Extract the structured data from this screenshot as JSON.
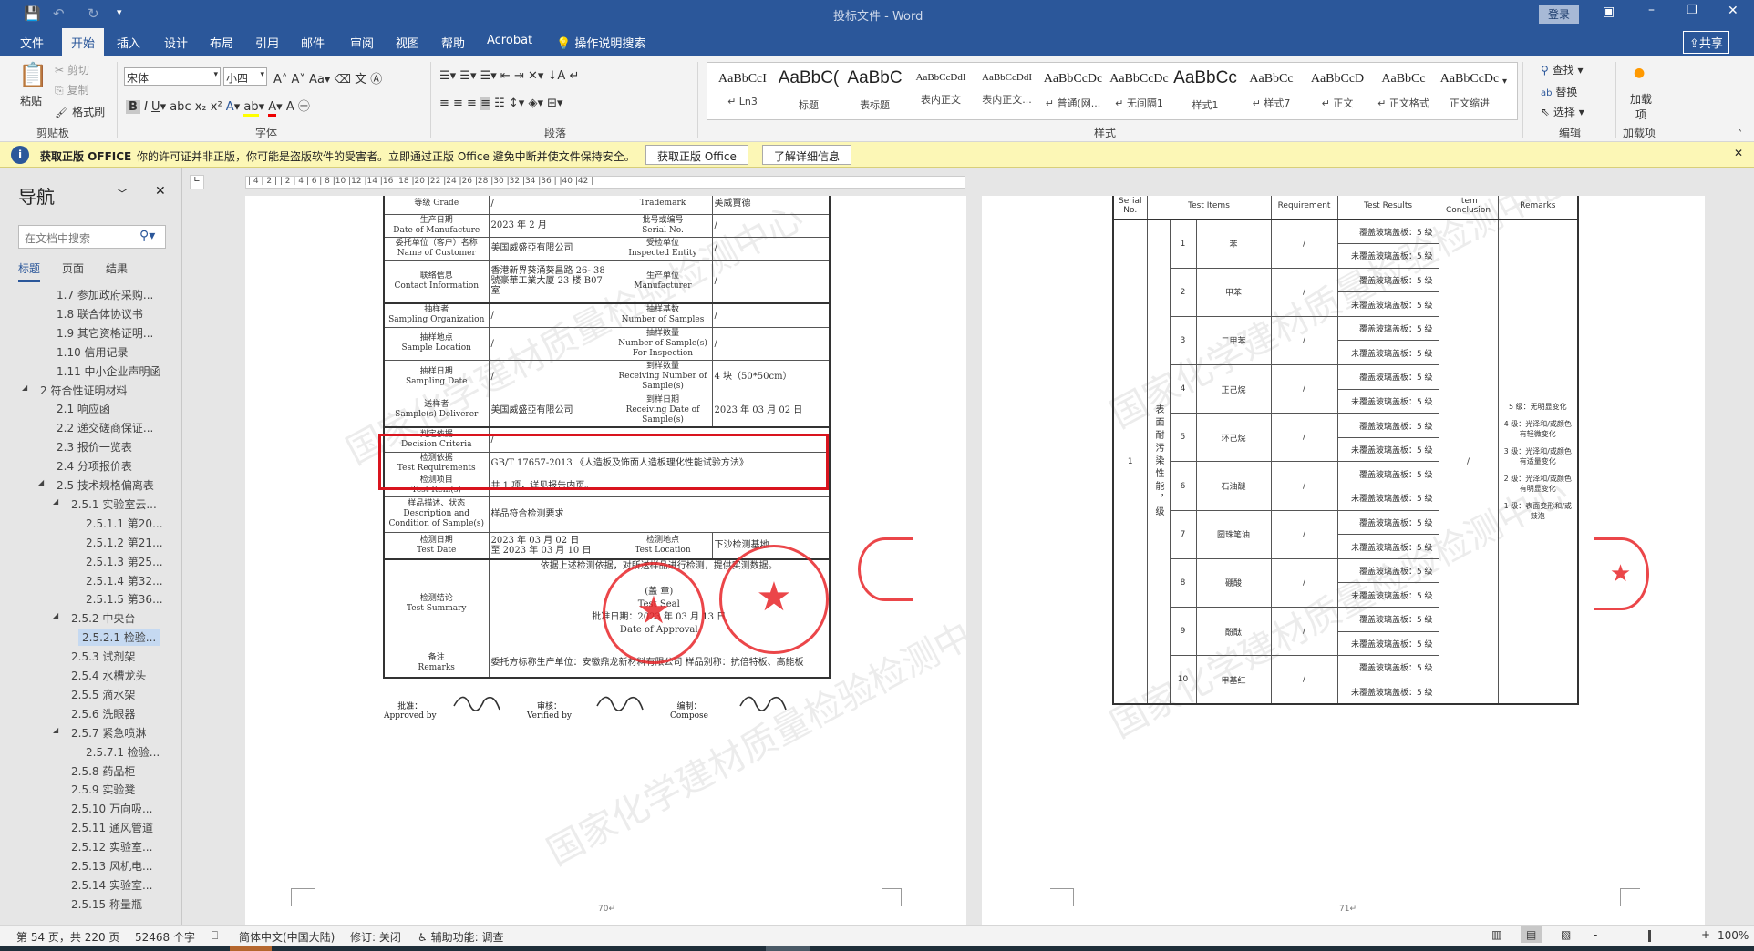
{
  "window": {
    "title": "投标文件 - Word",
    "login": "登录",
    "share": "共享"
  },
  "tabs": [
    "文件",
    "开始",
    "插入",
    "设计",
    "布局",
    "引用",
    "邮件",
    "审阅",
    "视图",
    "帮助",
    "Acrobat"
  ],
  "tell_me": "操作说明搜索",
  "ribbon": {
    "clipboard": {
      "paste": "粘贴",
      "cut": "剪切",
      "copy": "复制",
      "format_painter": "格式刷",
      "label": "剪贴板"
    },
    "font": {
      "name": "宋体",
      "size": "小四",
      "label": "字体"
    },
    "paragraph": {
      "label": "段落"
    },
    "styles": {
      "label": "样式",
      "items": [
        {
          "preview": "AaBbCcI",
          "name": "↵ Ln3"
        },
        {
          "preview": "AaBbC(",
          "name": "标题"
        },
        {
          "preview": "AaBbC",
          "name": "表标题"
        },
        {
          "preview": "AaBbCcDdI",
          "name": "表内正文"
        },
        {
          "preview": "AaBbCcDdI",
          "name": "表内正文..."
        },
        {
          "preview": "AaBbCcDc",
          "name": "↵ 普通(网..."
        },
        {
          "preview": "AaBbCcDc",
          "name": "↵ 无间隔1"
        },
        {
          "preview": "AaBbCc",
          "name": "样式1"
        },
        {
          "preview": "AaBbCc",
          "name": "↵ 样式7"
        },
        {
          "preview": "AaBbCcD",
          "name": "↵ 正文"
        },
        {
          "preview": "AaBbCc",
          "name": "↵ 正文格式"
        },
        {
          "preview": "AaBbCcDc",
          "name": "正文缩进"
        }
      ]
    },
    "editing": {
      "find": "查找",
      "replace": "替换",
      "select": "选择",
      "label": "编辑"
    },
    "addins": {
      "button": "加载项",
      "label": "加载项"
    }
  },
  "message_bar": {
    "title": "获取正版 OFFICE",
    "text": "你的许可证并非正版，你可能是盗版软件的受害者。立即通过正版 Office 避免中断并使文件保持安全。",
    "btn1": "获取正版 Office",
    "btn2": "了解详细信息"
  },
  "nav": {
    "title": "导航",
    "search_placeholder": "在文档中搜索",
    "tabs": [
      "标题",
      "页面",
      "结果"
    ],
    "items": [
      {
        "t": "1.7 参加政府采购...",
        "l": 3
      },
      {
        "t": "1.8 联合体协议书",
        "l": 3
      },
      {
        "t": "1.9 其它资格证明...",
        "l": 3
      },
      {
        "t": "1.10 信用记录",
        "l": 3
      },
      {
        "t": "1.11 中小企业声明函",
        "l": 3
      },
      {
        "t": "2 符合性证明材料",
        "l": 1,
        "c": true
      },
      {
        "t": "2.1 响应函",
        "l": 3
      },
      {
        "t": "2.2 递交磋商保证...",
        "l": 3
      },
      {
        "t": "2.3 报价一览表",
        "l": 3
      },
      {
        "t": "2.4 分项报价表",
        "l": 3
      },
      {
        "t": "2.5 技术规格偏离表",
        "l": 3,
        "c": true
      },
      {
        "t": "2.5.1 实验室云...",
        "l": 4,
        "c": true
      },
      {
        "t": "2.5.1.1 第20...",
        "l": 5
      },
      {
        "t": "2.5.1.2 第21...",
        "l": 5
      },
      {
        "t": "2.5.1.3 第25...",
        "l": 5
      },
      {
        "t": "2.5.1.4 第32...",
        "l": 5
      },
      {
        "t": "2.5.1.5 第36...",
        "l": 5
      },
      {
        "t": "2.5.2 中央台",
        "l": 4,
        "c": true
      },
      {
        "t": "2.5.2.1 检验...",
        "l": 5,
        "sel": true
      },
      {
        "t": "2.5.3 试剂架",
        "l": 4
      },
      {
        "t": "2.5.4 水槽龙头",
        "l": 4
      },
      {
        "t": "2.5.5 滴水架",
        "l": 4
      },
      {
        "t": "2.5.6 洗眼器",
        "l": 4
      },
      {
        "t": "2.5.7 紧急喷淋",
        "l": 4,
        "c": true
      },
      {
        "t": "2.5.7.1 检验...",
        "l": 5
      },
      {
        "t": "2.5.8 药品柜",
        "l": 4
      },
      {
        "t": "2.5.9 实验凳",
        "l": 4
      },
      {
        "t": "2.5.10 万向吸...",
        "l": 4
      },
      {
        "t": "2.5.11 通风管道",
        "l": 4
      },
      {
        "t": "2.5.12 实验室...",
        "l": 4
      },
      {
        "t": "2.5.13 风机电...",
        "l": 4
      },
      {
        "t": "2.5.14 实验室...",
        "l": 4
      },
      {
        "t": "2.5.15 称量瓶",
        "l": 4
      }
    ]
  },
  "ruler": "| 4 |  2 |  | 2 | 4 | 6 | 8 |10 |12 |14 |16 |18 |20 |22 |24 |26 |28 |30 |32 |34 |36 |  |40 |42 |",
  "left_page": {
    "rows": [
      [
        {
          "t": "等级 Grade"
        },
        {
          "t": "/",
          "v": 1
        },
        {
          "t": "Trademark"
        },
        {
          "t": "美威賈德",
          "v": 1
        }
      ],
      [
        {
          "t": "生产日期\nDate of Manufacture"
        },
        {
          "t": "2023 年 2 月",
          "v": 1
        },
        {
          "t": "批号或编号\nSerial No."
        },
        {
          "t": "/",
          "v": 1
        }
      ],
      [
        {
          "t": "委托单位（客户）名称\nName of Customer"
        },
        {
          "t": "美国威盛亞有限公司",
          "v": 1
        },
        {
          "t": "受检单位\nInspected Entity"
        },
        {
          "t": "/",
          "v": 1
        }
      ],
      [
        {
          "t": "联络信息\nContact Information"
        },
        {
          "t": "香港新界葵涌葵昌路 26- 38 號豪華工業大厦 23 楼 B07 室",
          "v": 1
        },
        {
          "t": "生产单位\nManufacturer"
        },
        {
          "t": "/",
          "v": 1
        }
      ],
      [
        {
          "t": "抽样者\nSampling Organization"
        },
        {
          "t": "/",
          "v": 1
        },
        {
          "t": "抽样基数\nNumber of Samples"
        },
        {
          "t": "/",
          "v": 1
        }
      ],
      [
        {
          "t": "抽样地点\nSample Location"
        },
        {
          "t": "/",
          "v": 1
        },
        {
          "t": "抽样数量\nNumber of Sample(s)\nFor Inspection"
        },
        {
          "t": "/",
          "v": 1
        }
      ],
      [
        {
          "t": "抽样日期\nSampling Date"
        },
        {
          "t": "/",
          "v": 1
        },
        {
          "t": "到样数量\nReceiving Number of\nSample(s)"
        },
        {
          "t": "4 块（50*50cm）",
          "v": 1
        }
      ],
      [
        {
          "t": "送样者\nSample(s) Deliverer"
        },
        {
          "t": "美国威盛亞有限公司",
          "v": 1
        },
        {
          "t": "到样日期\nReceiving Date of\nSample(s)"
        },
        {
          "t": "2023 年 03 月 02 日",
          "v": 1
        }
      ],
      [
        {
          "t": "判定依据\nDecision Criteria"
        },
        {
          "t": "/",
          "v": 1,
          "s": 3
        }
      ],
      [
        {
          "t": "检测依据\nTest Requirements"
        },
        {
          "t": "GB/T 17657-2013 《人造板及饰面人造板理化性能试验方法》",
          "v": 1,
          "s": 3
        }
      ],
      [
        {
          "t": "检测项目\nTest Item(s)"
        },
        {
          "t": "共 1 项，详见报告内页。",
          "v": 1,
          "s": 3
        }
      ],
      [
        {
          "t": "样品描述、状态\nDescription and\nCondition of Sample(s)"
        },
        {
          "t": "样品符合检测要求",
          "v": 1,
          "s": 3
        }
      ],
      [
        {
          "t": "检测日期\nTest Date"
        },
        {
          "t": "2023 年 03 月 02 日\n至  2023 年 03 月 10 日",
          "v": 1
        },
        {
          "t": "检测地点\nTest Location"
        },
        {
          "t": "下沙检测基地",
          "v": 1
        }
      ],
      [
        {
          "t": "检测结论\nTest Summary"
        },
        {
          "t": "依据上述检测依据，对所送样品进行检测，提供实测数据。\n\n(盖 章)\nTest Seal\n批准日期：2023 年 03 月 13 日\nDate of Approval",
          "v": 1,
          "s": 3
        }
      ],
      [
        {
          "t": "备注\nRemarks"
        },
        {
          "t": "委托方标称生产单位：安徽鼎龙新材料有限公司  样品别称：抗倍特板、高能板",
          "v": 1,
          "s": 3
        }
      ]
    ],
    "signatures": [
      {
        "cn": "批准：",
        "en": "Approved by"
      },
      {
        "cn": "审核：",
        "en": "Verified by"
      },
      {
        "cn": "编制：",
        "en": "Compose"
      }
    ],
    "seals": [
      "浙江方圆检测集团股份有限公司 检验检测专用章",
      "国家化学建材质量检验检测中心 检验检测专用章"
    ],
    "page_number": "70↵"
  },
  "right_page": {
    "headers": [
      "Serial No.",
      "Test Items",
      "Requirement",
      "Test Results",
      "Item Conclusion",
      "Remarks"
    ],
    "serial": "1",
    "category": "表面耐污染性能，级",
    "conclusion": "/",
    "items": [
      {
        "n": "1",
        "name": "苯"
      },
      {
        "n": "2",
        "name": "甲苯"
      },
      {
        "n": "3",
        "name": "二甲苯"
      },
      {
        "n": "4",
        "name": "正己烷"
      },
      {
        "n": "5",
        "name": "环己烷"
      },
      {
        "n": "6",
        "name": "石油醚"
      },
      {
        "n": "7",
        "name": "圆珠笔油"
      },
      {
        "n": "8",
        "name": "硼酸"
      },
      {
        "n": "9",
        "name": "酚酞"
      },
      {
        "n": "10",
        "name": "甲基红"
      }
    ],
    "requirement": "/",
    "results": [
      "覆盖玻璃盖板：5 级",
      "未覆盖玻璃盖板：5 级"
    ],
    "remarks": [
      "5 级：无明显变化",
      "4 级：光泽和/或颜色有轻微变化",
      "3 级：光泽和/或颜色有适量变化",
      "2 级：光泽和/或颜色有明显变化",
      "1 级：表面变形和/或鼓泡"
    ],
    "page_number": "71↵"
  },
  "watermark": "国家化学建材质量检验检测中心",
  "status": {
    "page": "第 54 页，共 220 页",
    "words": "52468 个字",
    "language": "简体中文(中国大陆)",
    "track": "修订: 关闭",
    "accessibility": "辅助功能: 调查",
    "zoom": "100%",
    "zoom_percent": 100
  },
  "colors": {
    "accent": "#2b579a",
    "highlight_box": "#d9141e",
    "seal": "#e8262a"
  }
}
